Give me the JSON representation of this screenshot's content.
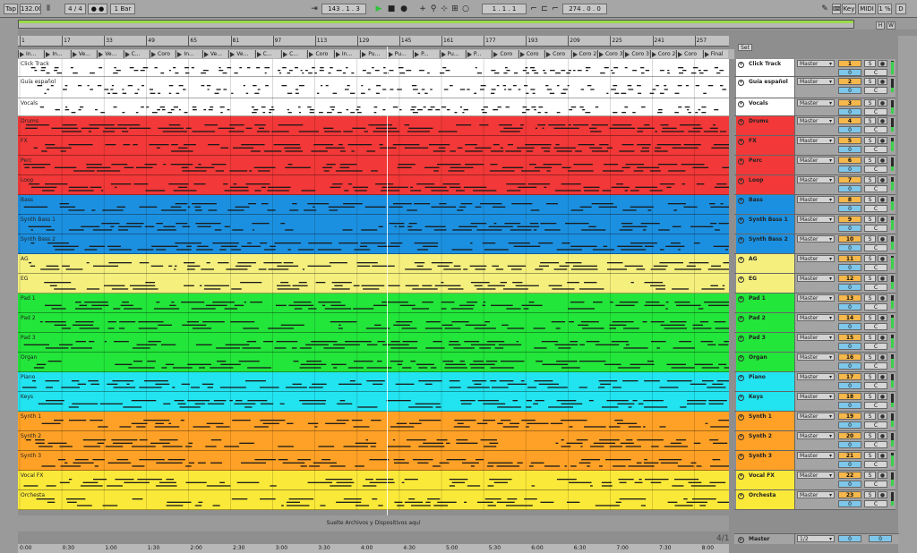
{
  "transport": {
    "tap_label": "Tap",
    "tempo": "132.00",
    "pause_icon": "pause-bars-icon",
    "time_signature": "4 / 4",
    "metronome_label": "● ●",
    "quantization": "1 Bar",
    "position": "143 .   1 .   3",
    "follow_icon": "follow-arrow-icon",
    "loop_start": "1 .   1 .   1",
    "loop_length": "274 .   0 .   0",
    "key_label": "Key",
    "midi_label": "MIDI",
    "cpu_label": "1 %",
    "disk_label": "D"
  },
  "right_buttons": {
    "h_label": "H",
    "w_label": "W"
  },
  "set_label": "Set",
  "bar_labels": [
    "1",
    "17",
    "33",
    "49",
    "65",
    "81",
    "97",
    "113",
    "129",
    "145",
    "161",
    "177",
    "193",
    "209",
    "225",
    "241",
    "257"
  ],
  "locators": [
    "In...",
    "In...",
    "Ve...",
    "Ve...",
    "C...",
    "Coro",
    "In...",
    "Ve...",
    "Ve...",
    "C...",
    "C...",
    "Coro",
    "In...",
    "Pu...",
    "Pu...",
    "P...",
    "Pu...",
    "P...",
    "Coro",
    "Coro",
    "Coro",
    "Coro 2",
    "Coro 3",
    "Coro 3",
    "Coro 2",
    "Coro",
    "Final"
  ],
  "tracks": [
    {
      "name": "Click Track",
      "color": "#ffffff",
      "height": 20,
      "send": "Master",
      "number": "1",
      "volume": "0",
      "solo": "S",
      "cross": "C"
    },
    {
      "name": "Guía español",
      "color": "#ffffff",
      "height": 24,
      "send": "Master",
      "number": "2",
      "volume": "0",
      "solo": "S",
      "cross": "C"
    },
    {
      "name": "Vocals",
      "color": "#ffffff",
      "height": 20,
      "send": "Master",
      "number": "3",
      "volume": "0",
      "solo": "S",
      "cross": "C"
    },
    {
      "name": "Drums",
      "color": "#f23838",
      "height": 22,
      "send": "Master",
      "number": "4",
      "volume": "0",
      "solo": "S",
      "cross": "C"
    },
    {
      "name": "FX",
      "color": "#f23838",
      "height": 22,
      "send": "Master",
      "number": "5",
      "volume": "0",
      "solo": "S",
      "cross": "C"
    },
    {
      "name": "Perc",
      "color": "#f23838",
      "height": 22,
      "send": "Master",
      "number": "6",
      "volume": "0",
      "solo": "S",
      "cross": "C"
    },
    {
      "name": "Loop",
      "color": "#f23838",
      "height": 22,
      "send": "Master",
      "number": "7",
      "volume": "0",
      "solo": "S",
      "cross": "C"
    },
    {
      "name": "Bass",
      "color": "#1c90e0",
      "height": 22,
      "send": "Master",
      "number": "8",
      "volume": "0",
      "solo": "S",
      "cross": "C"
    },
    {
      "name": "Synth Bass 1",
      "color": "#1c90e0",
      "height": 22,
      "send": "Master",
      "number": "9",
      "volume": "0",
      "solo": "S",
      "cross": "C"
    },
    {
      "name": "Synth Bass 2",
      "color": "#1c90e0",
      "height": 22,
      "send": "Master",
      "number": "10",
      "volume": "0",
      "solo": "S",
      "cross": "C"
    },
    {
      "name": "AG",
      "color": "#f5ef7e",
      "height": 22,
      "send": "Master",
      "number": "11",
      "volume": "0",
      "solo": "S",
      "cross": "C"
    },
    {
      "name": "EG",
      "color": "#f5ef7e",
      "height": 22,
      "send": "Master",
      "number": "12",
      "volume": "0",
      "solo": "S",
      "cross": "C"
    },
    {
      "name": "Pad 1",
      "color": "#22e63a",
      "height": 22,
      "send": "Master",
      "number": "13",
      "volume": "0",
      "solo": "S",
      "cross": "C"
    },
    {
      "name": "Pad 2",
      "color": "#22e63a",
      "height": 22,
      "send": "Master",
      "number": "14",
      "volume": "0",
      "solo": "S",
      "cross": "C"
    },
    {
      "name": "Pad 3",
      "color": "#22e63a",
      "height": 22,
      "send": "Master",
      "number": "15",
      "volume": "0",
      "solo": "S",
      "cross": "C"
    },
    {
      "name": "Organ",
      "color": "#22e63a",
      "height": 22,
      "send": "Master",
      "number": "16",
      "volume": "0",
      "solo": "S",
      "cross": "C"
    },
    {
      "name": "Piano",
      "color": "#22e3f0",
      "height": 22,
      "send": "Master",
      "number": "17",
      "volume": "0",
      "solo": "S",
      "cross": "C"
    },
    {
      "name": "Keys",
      "color": "#22e3f0",
      "height": 22,
      "send": "Master",
      "number": "18",
      "volume": "0",
      "solo": "S",
      "cross": "C"
    },
    {
      "name": "Synth 1",
      "color": "#ffa126",
      "height": 22,
      "send": "Master",
      "number": "19",
      "volume": "0",
      "solo": "S",
      "cross": "C"
    },
    {
      "name": "Synth 2",
      "color": "#ffa126",
      "height": 22,
      "send": "Master",
      "number": "20",
      "volume": "0",
      "solo": "S",
      "cross": "C"
    },
    {
      "name": "Synth 3",
      "color": "#ffa126",
      "height": 22,
      "send": "Master",
      "number": "21",
      "volume": "0",
      "solo": "S",
      "cross": "C"
    },
    {
      "name": "Vocal FX",
      "color": "#fbe93a",
      "height": 22,
      "send": "Master",
      "number": "22",
      "volume": "0",
      "solo": "S",
      "cross": "C"
    },
    {
      "name": "Orchesta",
      "color": "#fbe93a",
      "height": 22,
      "send": "Master",
      "number": "23",
      "volume": "0",
      "solo": "S",
      "cross": "C"
    }
  ],
  "drop_zone_text": "Suelte Archivos y Dispositivos aquí",
  "master": {
    "name": "Master",
    "send": "1/2",
    "volume": "0",
    "volume2": "0"
  },
  "page_indicator": "4/1",
  "time_labels": [
    "0:00",
    "0:30",
    "1:00",
    "1:30",
    "2:00",
    "2:30",
    "3:00",
    "3:30",
    "4:00",
    "4:30",
    "5:00",
    "5:30",
    "6:00",
    "6:30",
    "7:00",
    "7:30",
    "8:00"
  ],
  "colors": {
    "accent_play": "#3ad14b",
    "overview_green": "#9adb4b",
    "number_box": "#f7b84b",
    "volume_box": "#7ec7ea"
  }
}
